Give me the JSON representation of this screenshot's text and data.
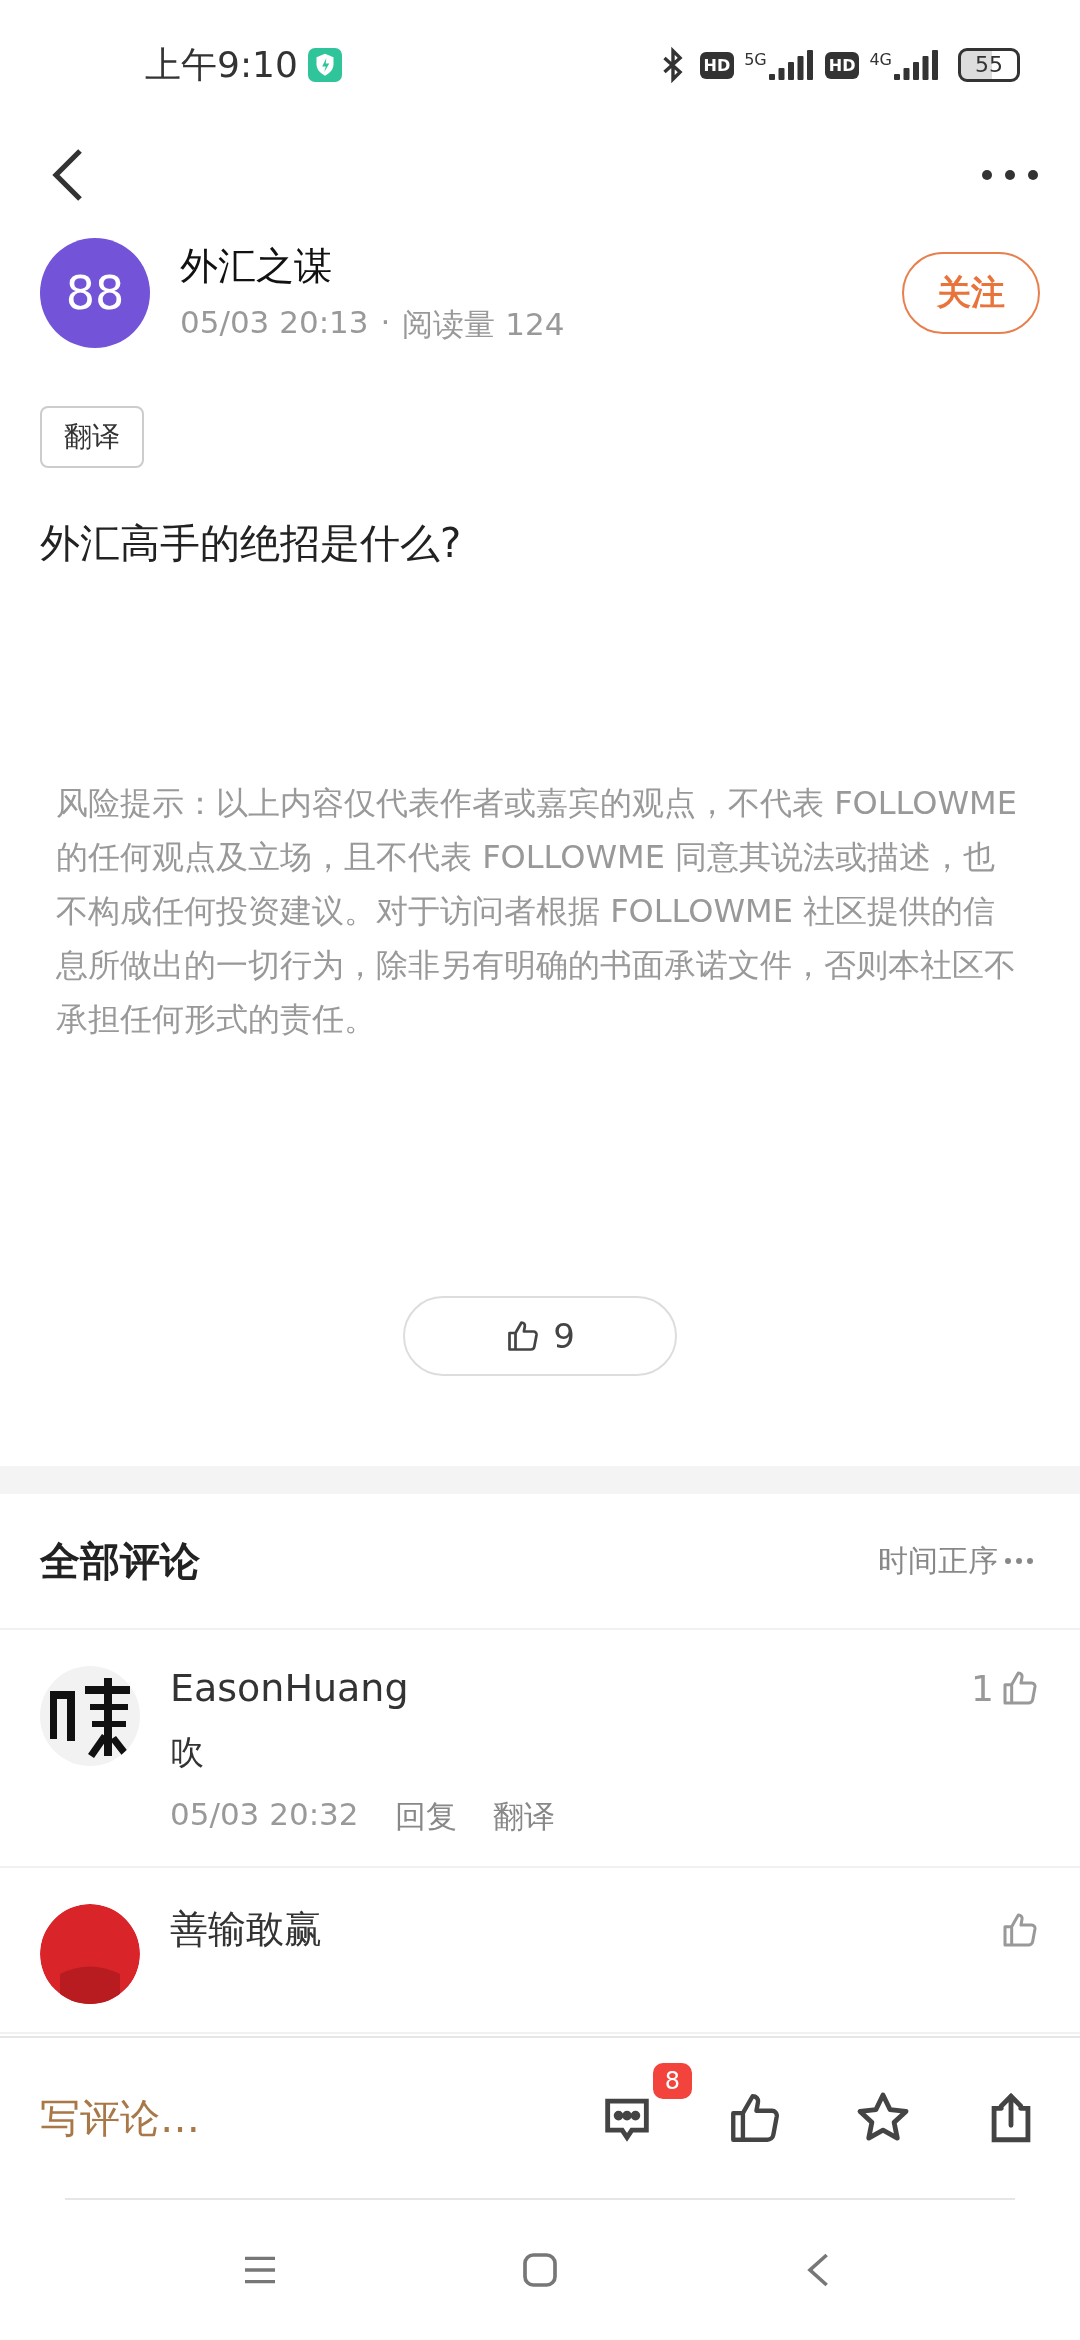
{
  "status_bar": {
    "time": "上午9:10",
    "hd_1": "HD",
    "network_1": "5G",
    "hd_2": "HD",
    "network_2": "4G",
    "battery": "55"
  },
  "author": {
    "avatar_text": "88",
    "name": "外汇之谋",
    "date": "05/03 20:13",
    "separator": "·",
    "views": "阅读量 124",
    "follow_label": "关注",
    "following": false
  },
  "translate_tag": "翻译",
  "post_title": "外汇高手的绝招是什么?",
  "disclaimer": "风险提示：以上内容仅代表作者或嘉宾的观点，不代表 FOLLOWME 的任何观点及立场，且不代表 FOLLOWME 同意其说法或描述，也不构成任何投资建议。对于访问者根据 FOLLOWME 社区提供的信息所做出的一切行为，除非另有明确的书面承诺文件，否则本社区不承担任何形式的责任。",
  "like_count": "9",
  "comments_header": {
    "title": "全部评论",
    "sort": "时间正序"
  },
  "comments": [
    {
      "name": "EasonHuang",
      "likes": "1",
      "text": "吹",
      "date": "05/03 20:32",
      "reply": "回复",
      "translate": "翻译"
    },
    {
      "name": "善输敢赢"
    }
  ],
  "bottom_bar": {
    "comment_placeholder": "写评论…",
    "comment_badge": "8"
  }
}
